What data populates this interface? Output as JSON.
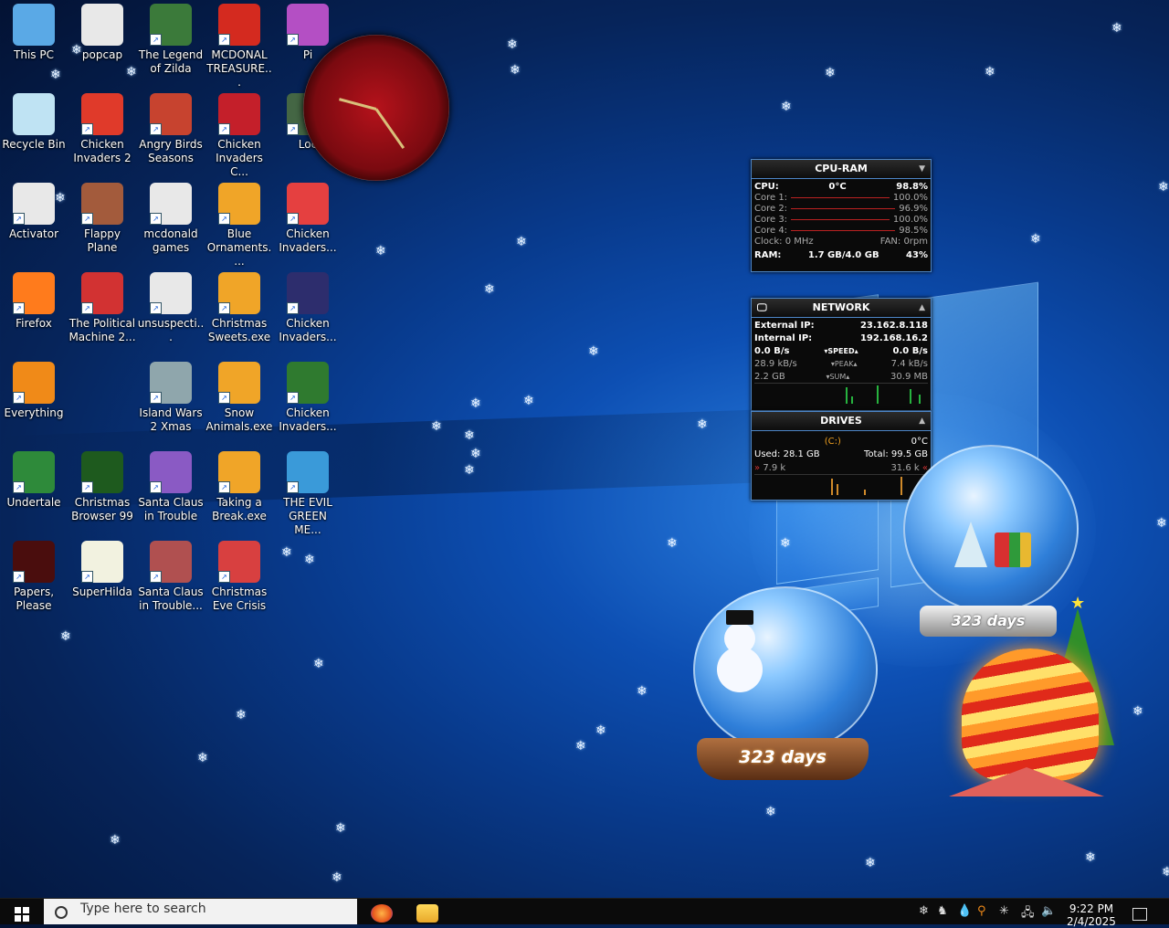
{
  "desktop": {
    "icons": [
      {
        "label": "This PC",
        "icon": "this-pc-icon",
        "color": "#5aa9e6"
      },
      {
        "label": "popcap",
        "icon": "folder-icon",
        "color": "#e8e8e8"
      },
      {
        "label": "The Legend of Zilda",
        "icon": "game-icon",
        "color": "#3b7a3a"
      },
      {
        "label": "MCDONAL TREASURE...",
        "icon": "mcdonalds-icon",
        "color": "#d42a1f"
      },
      {
        "label": "Pi",
        "icon": "game-icon",
        "color": "#b44fc4"
      },
      {
        "label": "Recycle Bin",
        "icon": "recycle-bin-icon",
        "color": "#bfe3f3"
      },
      {
        "label": "Chicken Invaders 2",
        "icon": "chicken-icon",
        "color": "#e03a2a"
      },
      {
        "label": "Angry Birds Seasons",
        "icon": "angry-birds-icon",
        "color": "#c7432f"
      },
      {
        "label": "Chicken Invaders C...",
        "icon": "chicken-icon",
        "color": "#c41f2a"
      },
      {
        "label": "Loc",
        "icon": "game-icon",
        "color": "#446644"
      },
      {
        "label": "Activator",
        "icon": "file-icon",
        "color": "#e8e8e8"
      },
      {
        "label": "Flappy Plane",
        "icon": "game-icon",
        "color": "#a35b3c"
      },
      {
        "label": "mcdonald games",
        "icon": "file-icon",
        "color": "#e8e8e8"
      },
      {
        "label": "Blue Ornaments....",
        "icon": "popcap-icon",
        "color": "#f0a528"
      },
      {
        "label": "Chicken Invaders...",
        "icon": "chicken-icon",
        "color": "#e54040"
      },
      {
        "label": "Firefox",
        "icon": "firefox-icon",
        "color": "#ff7b1c"
      },
      {
        "label": "The Political Machine 2...",
        "icon": "game-icon",
        "color": "#d23232"
      },
      {
        "label": "unsuspecti...",
        "icon": "file-icon",
        "color": "#e8e8e8"
      },
      {
        "label": "Christmas Sweets.exe",
        "icon": "popcap-icon",
        "color": "#f0a528"
      },
      {
        "label": "Chicken Invaders...",
        "icon": "chicken-icon",
        "color": "#2d2d6d"
      },
      {
        "label": "Everything",
        "icon": "search-icon",
        "color": "#f08a18"
      },
      {
        "label": "Island Wars 2 Xmas",
        "icon": "game-icon",
        "color": "#8fa6ac"
      },
      {
        "label": "Snow Animals.exe",
        "icon": "popcap-icon",
        "color": "#f0a528"
      },
      {
        "label": "Chicken Invaders...",
        "icon": "chicken-icon",
        "color": "#2f7a2f"
      },
      {
        "label": "Undertale",
        "icon": "undertale-icon",
        "color": "#2e8a3a"
      },
      {
        "label": "Christmas Browser 99",
        "icon": "christmas-tree-icon",
        "color": "#1e5a1e"
      },
      {
        "label": "Santa Claus in Trouble",
        "icon": "santa-icon",
        "color": "#8a5ac4"
      },
      {
        "label": "Taking a Break.exe",
        "icon": "popcap-icon",
        "color": "#f0a528"
      },
      {
        "label": "THE EVIL GREEN ME...",
        "icon": "messenger-icon",
        "color": "#3a9ad9"
      },
      {
        "label": "Papers, Please",
        "icon": "game-icon",
        "color": "#4a0d0d"
      },
      {
        "label": "SuperHilda",
        "icon": "game-icon",
        "color": "#f2f2e0"
      },
      {
        "label": "Santa Claus in Trouble...",
        "icon": "santa-icon",
        "color": "#b05050"
      },
      {
        "label": "Christmas Eve Crisis",
        "icon": "santa-icon",
        "color": "#d84040"
      }
    ]
  },
  "cpu_widget": {
    "title": "CPU-RAM",
    "cpu_label": "CPU:",
    "cpu_temp": "0°C",
    "cpu_value": "98.8%",
    "cores": [
      {
        "label": "Core 1:",
        "value": "100.0%"
      },
      {
        "label": "Core 2:",
        "value": "96.9%"
      },
      {
        "label": "Core 3:",
        "value": "100.0%"
      },
      {
        "label": "Core 4:",
        "value": "98.5%"
      }
    ],
    "clock": "Clock: 0 MHz",
    "fan": "FAN: 0rpm",
    "ram_label": "RAM:",
    "ram_value": "1.7 GB/4.0 GB",
    "ram_pct": "43%"
  },
  "network_widget": {
    "title": "NETWORK",
    "external_label": "External IP:",
    "external_ip": "23.162.8.118",
    "internal_label": "Internal IP:",
    "internal_ip": "192.168.16.2",
    "speed_down": "0.0 B/s",
    "speed_label": "SPEED",
    "speed_up": "0.0 B/s",
    "peak_down": "28.9 kB/s",
    "peak_label": "PEAK",
    "peak_up": "7.4 kB/s",
    "sum_down": "2.2 GB",
    "sum_label": "SUM",
    "sum_up": "30.9 MB"
  },
  "drives_widget": {
    "title": "DRIVES",
    "drive": "(C:)",
    "temp": "0°C",
    "used": "Used: 28.1 GB",
    "total": "Total: 99.5 GB",
    "read": "7.9 k",
    "write": "31.6 k"
  },
  "globes": {
    "left_days": "323 days",
    "right_days": "323 days"
  },
  "taskbar": {
    "search_placeholder": "Type here to search",
    "time": "9:22 PM",
    "date": "2/4/2025"
  },
  "colors": {
    "widget_border": "#4d86c7",
    "accent_red": "#b22222",
    "taskbar": "#0b0b0b"
  }
}
